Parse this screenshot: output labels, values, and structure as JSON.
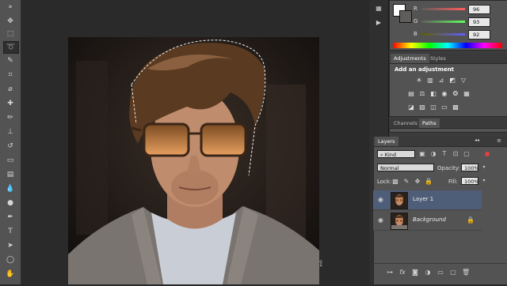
{
  "color_panel": {
    "channels": [
      {
        "label": "R",
        "value": "96"
      },
      {
        "label": "G",
        "value": "93"
      },
      {
        "label": "B",
        "value": "92"
      }
    ]
  },
  "adjustments_panel": {
    "tabs": [
      "Adjustments",
      "Styles"
    ],
    "heading": "Add an adjustment"
  },
  "paths_tabs": [
    "Channels",
    "Paths"
  ],
  "layers_panel": {
    "tab": "Layers",
    "filter_kind": "Kind",
    "blend_mode": "Normal",
    "opacity_label": "Opacity:",
    "opacity_value": "100%",
    "lock_label": "Lock:",
    "fill_label": "Fill:",
    "fill_value": "100%",
    "layers": [
      {
        "name": "Layer 1",
        "selected": true
      },
      {
        "name": "Background",
        "selected": false
      }
    ]
  },
  "colors": {
    "accent_selected_layer": "#4f5e78",
    "panel_bg": "#535353"
  }
}
